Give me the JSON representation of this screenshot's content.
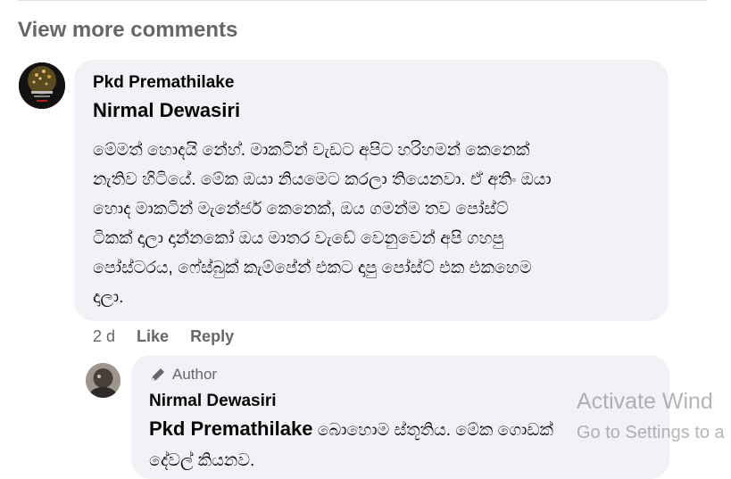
{
  "view_more_label": "View more comments",
  "comment": {
    "author": "Pkd Premathilake",
    "reply_to": "Nirmal Dewasiri",
    "text_lines": [
      "මේමත් හොදයි නේහ්. මාකටින් වැඩට අපිට හරිහමන් කෙනෙක්",
      "නැතිව හිටියේ. මේක ඔයා නියමෙට කරලා තියෙනවා. ඒ අතිං ඔයා",
      "හොද මාකටින් මැනේජර් කෙනෙක්, ඔය ගමන්ම තව පෝස්ට්",
      "ටිකක් දාලා දාන්නකෝ ඔය මාතර වැඩේ වෙනුවෙන් අපි ගහපු",
      "පෝස්ටරය, ෆේස්බුක් කැම්පේන් එකට දාපු පෝස්ට් එක එකහෙම",
      "දාලා."
    ],
    "time": "2 d",
    "like_label": "Like",
    "reply_label": "Reply"
  },
  "reply": {
    "badge_label": "Author",
    "author": "Nirmal Dewasiri",
    "mention": "Pkd Premathilake",
    "text_line1": "බොහොම ස්තූතිය. මේක ගොඩක්",
    "text_line2": "දේවල් කියනව."
  },
  "watermark": {
    "line1": "Activate Wind",
    "line2": "Go to Settings to a"
  },
  "colors": {
    "bubble": "#f0f2f5",
    "secondary_text": "#65676b"
  }
}
